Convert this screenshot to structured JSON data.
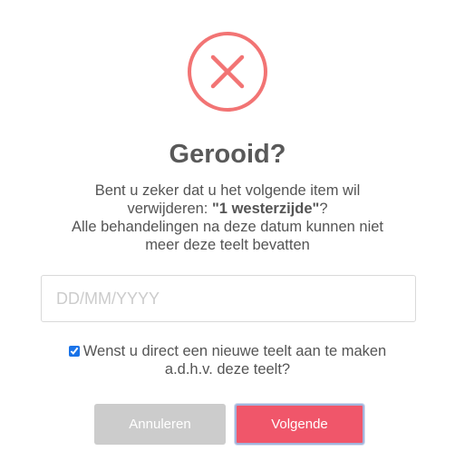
{
  "dialog": {
    "title": "Gerooid?",
    "message": {
      "line1": "Bent u zeker dat u het volgende item wil",
      "line2_prefix": "verwijderen: ",
      "item_name": "\"1 westerzijde\"",
      "line2_suffix": "?",
      "line3": "Alle behandelingen na deze datum kunnen niet",
      "line4": "meer deze teelt bevatten"
    },
    "date_input": {
      "placeholder": "DD/MM/YYYY",
      "value": ""
    },
    "checkbox": {
      "checked": true,
      "label_line1": "Wenst u direct een nieuwe teelt aan te maken",
      "label_line2": "a.d.h.v. deze teelt?"
    },
    "buttons": {
      "cancel_label": "Annuleren",
      "next_label": "Volgende"
    },
    "icon": "error-x-icon",
    "colors": {
      "error": "#f27474",
      "confirm": "#f0566a",
      "cancel": "#cccccc"
    }
  }
}
